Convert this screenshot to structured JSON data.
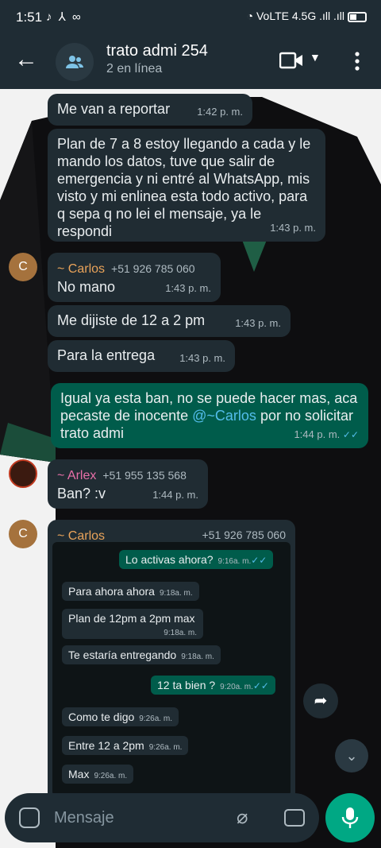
{
  "status": {
    "time": "1:51",
    "left_icons": "♪ ⅄ ∞",
    "right_icons": "◔ VoLTE 4.5G .ıll .ıll"
  },
  "header": {
    "title": "trato admi 254",
    "subtitle": "2 en línea"
  },
  "messages": [
    {
      "text": "Me van a reportar",
      "time": "1:42 p. m."
    },
    {
      "text": "Plan de 7 a 8 estoy llegando a cada y le mando los datos, tuve que salir de emergencia y ni entré al WhatsApp, mis visto y mi enlinea esta todo activo,  para q sepa q no lei el mensaje, ya le respondi",
      "time": "1:43 p. m."
    },
    {
      "sender": "~ Carlos",
      "phone": "+51 926 785 060",
      "text": "No mano",
      "time": "1:43 p. m."
    },
    {
      "text": "Me dijiste de 12 a 2 pm",
      "time": "1:43 p. m."
    },
    {
      "text": "Para la entrega",
      "time": "1:43 p. m."
    },
    {
      "text_before": "Igual ya esta ban, no se puede hacer mas, aca pecaste de inocente ",
      "mention": "@~Carlos",
      "text_after": "  por no solicitar trato admi",
      "time": "1:44 p. m.",
      "ticks": "✓✓"
    },
    {
      "sender": "~ Arlex",
      "phone": "+51 955 135 568",
      "text": "Ban? :v",
      "time": "1:44 p. m."
    },
    {
      "sender": "~ Carlos",
      "phone": "+51 926 785 060"
    }
  ],
  "avatars": {
    "carlos_letter": "C"
  },
  "screenshot_msgs": [
    {
      "text": "Lo activas ahora?",
      "time": "9:16a. m.",
      "ticks": "✓✓"
    },
    {
      "text": "Para ahora ahora",
      "time": "9:18a. m."
    },
    {
      "text": "Plan de 12pm a 2pm max",
      "time": "9:18a. m."
    },
    {
      "text": "Te estaría entregando",
      "time": "9:18a. m."
    },
    {
      "text": "12 ta bien ?",
      "time": "9:20a. m.",
      "ticks": "✓✓"
    },
    {
      "text": "Como te digo",
      "time": "9:26a. m."
    },
    {
      "text": "Entre 12 a 2pm",
      "time": "9:26a. m."
    },
    {
      "text": "Max",
      "time": "9:26a. m."
    }
  ],
  "composer": {
    "placeholder": "Mensaje"
  },
  "colors": {
    "header": "#1f2c34",
    "incoming": "#202c33",
    "outgoing": "#005c4b",
    "accent": "#00a884",
    "tick": "#53bdeb"
  }
}
